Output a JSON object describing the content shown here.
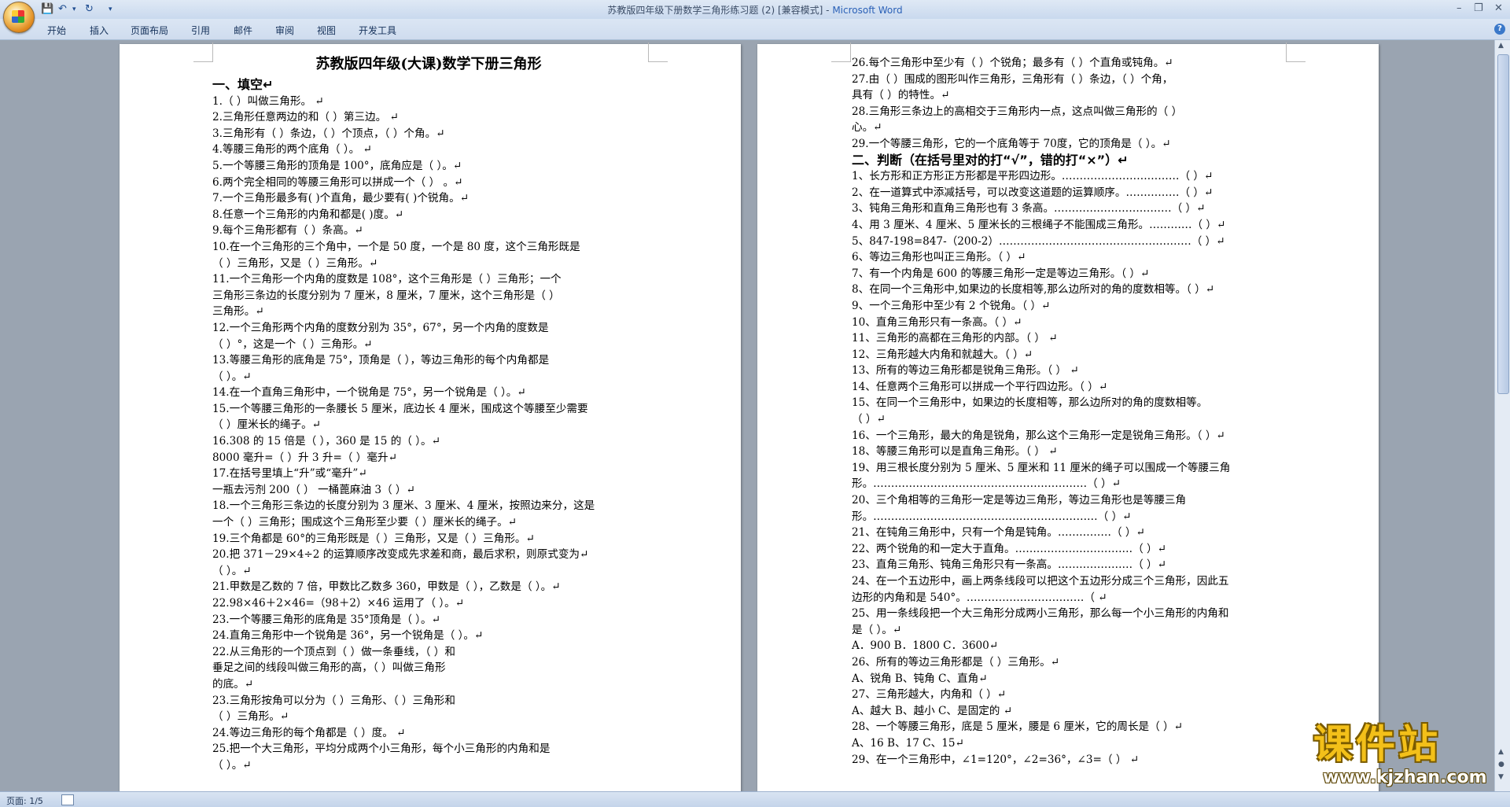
{
  "window": {
    "doc_title": "苏教版四年级下册数学三角形练习题 (2) [兼容模式] - ",
    "app_name": "Microsoft Word",
    "controls": [
      "–",
      "❐",
      "✕"
    ]
  },
  "ribbon": {
    "tabs": [
      "开始",
      "插入",
      "页面布局",
      "引用",
      "邮件",
      "审阅",
      "视图",
      "开发工具"
    ]
  },
  "left_page": {
    "title": "苏教版四年级(大课)数学下册三角形",
    "section1": "一、填空↵",
    "lines": [
      "1.（                    ）叫做三角形。 ↵",
      "2.三角形任意两边的和（            ）第三边。 ↵",
      "3.三角形有（        ）条边，（        ）个顶点，（        ）个角。↵",
      "4.等腰三角形的两个底角（            ）。 ↵",
      "5.一个等腰三角形的顶角是 100°，底角应是（          ）。↵",
      "6.两个完全相同的等腰三角形可以拼成一个（           ）                  。↵",
      "7.一个三角形最多有(       )个直角，最少要有(       )个锐角。↵",
      "8.任意一个三角形的内角和都是(       )度。↵",
      "9.每个三角形都有（      ）条高。↵",
      "10.在一个三角形的三个角中，一个是 50 度，一个是 80 度，这个三角形既是",
      "（            ）三角形，又是（            ）三角形。↵",
      "11.一个三角形一个内角的度数是 108°，这个三角形是（      ）三角形；一个",
      "三角形三条边的长度分别为 7 厘米，8 厘米，7 厘米，这个三角形是（       ）",
      "三角形。↵",
      "12.一个三角形两个内角的度数分别为 35°，67°，另一个内角的度数是",
      "（          ）°，这是一个（          ）三角形。↵",
      "13.等腰三角形的底角是 75°，顶角是（       ），等边三角形的每个内角都是",
      "（          ）。↵",
      "14.在一个直角三角形中，一个锐角是 75°，另一个锐角是（  ）。↵",
      "15.一个等腰三角形的一条腰长 5 厘米，底边长 4 厘米，围成这个等腰至少需要",
      "（        ）厘米长的绳子。↵",
      "16.308 的 15 倍是（        ），360 是 15 的（        ）。↵",
      "    8000 毫升=（        ）升     3 升=（        ）毫升↵",
      "17.在括号里填上“升”或“毫升”↵",
      "    一瓶去污剂 200（      ）          一桶蓖麻油 3（      ）↵",
      "18.一个三角形三条边的长度分别为 3 厘米、3 厘米、4 厘米，按照边来分，这是",
      "一个（        ）三角形；围成这个三角形至少要（      ）厘米长的绳子。↵",
      "19.三个角都是 60°的三角形既是（      ）三角形，又是（      ）三角形。↵",
      "20.把 371－29×4÷2 的运算顺序改变成先求差和商，最后求积，则原式变为↵",
      "（                        ）。↵",
      "21.甲数是乙数的 7 倍，甲数比乙数多 360，甲数是（      ），乙数是（      ）。↵",
      "22.98×46＋2×46=（98＋2）×46 运用了（            ）。↵",
      "23.一个等腰三角形的底角是 35°顶角是（        ）。↵",
      "24.直角三角形中一个锐角是 36°，另一个锐角是（       ）。↵",
      "22.从三角形的一个顶点到（                ）做一条垂线，（               ）和",
      "垂足之间的线段叫做三角形的高，（                              ）叫做三角形",
      "的底。↵",
      "23.三角形按角可以分为（            ）三角形、（              ）三角形和",
      "（            ）三角形。↵",
      "24.等边三角形的每个角都是（       ）度。 ↵",
      "25.把一个大三角形，平均分成两个小三角形，每个小三角形的内角和是",
      "（              ）。↵"
    ]
  },
  "right_page": {
    "lines_top": [
      "26.每个三角形中至少有（      ）个锐角；最多有（      ）个直角或钝角。↵",
      "27.由（        ）围成的图形叫作三角形，三角形有（        ）条边，（        ）个角，",
      "具有（        ）的特性。↵",
      "28.三角形三条边上的高相交于三角形内一点，这点叫做三角形的（              ）",
      "心。↵",
      "29.一个等腰三角形，它的一个底角等于 70度，它的顶角是（        ）。↵"
    ],
    "section2": "二、判断（在括号里对的打“√”，错的打“×”）↵",
    "lines_bottom": [
      "1、长方形和正方形正方形都是平形四边形。……………………………（    ）↵",
      "2、在一道算式中添减括号，可以改变这道题的运算顺序。……………（    ）↵",
      "3、钝角三角形和直角三角形也有 3 条高。……………………………（    ）↵",
      "4、用 3 厘米、4 厘米、5 厘米长的三根绳子不能围成三角形。…………（    ）↵",
      "5、847-198=847-（200-2）………………………………………………（    ）↵",
      "6、等边三角形也叫正三角形。（        ）↵",
      "7、有一个内角是 600 的等腰三角形一定是等边三角形。（        ）↵",
      "8、在同一个三角形中,如果边的长度相等,那么边所对的角的度数相等。（        ）↵",
      "9、一个三角形中至少有 2 个锐角。（        ）↵",
      "10、直角三角形只有一条高。（        ）↵",
      "11、三角形的高都在三角形的内部。（        ）  ↵",
      "12、三角形越大内角和就越大。（        ）↵",
      "13、所有的等边三角形都是锐角三角形。（        ）  ↵",
      "14、任意两个三角形可以拼成一个平行四边形。（            ）↵",
      "15、在同一个三角形中，如果边的长度相等，那么边所对的角的度数相等。",
      "（        ）↵",
      "16、一个三角形，最大的角是锐角，那么这个三角形一定是锐角三角形。（      ）↵",
      "18、等腰三角形可以是直角三角形。（        ）  ↵",
      "19、用三根长度分别为 5 厘米、5 厘米和 11 厘米的绳子可以围成一个等腰三角",
      "形。……………………………………………………（        ）↵",
      "20、三个角相等的三角形一定是等边三角形，等边三角形也是等腰三角",
      "形。………………………………………………………（    ）↵",
      "21、在钝角三角形中，只有一个角是钝角。……………（      ）↵",
      "22、两个锐角的和一定大于直角。……………………………（    ）↵",
      "23、直角三角形、钝角三角形只有一条高。…………………（    ）↵",
      "24、在一个五边形中，画上两条线段可以把这个五边形分成三个三角形，因此五",
      "边形的内角和是 540°。……………………………（    ↵",
      "25、用一条线段把一个大三角形分成两小三角形，那么每一个小三角形的内角和",
      "是（      ）。↵",
      "      A．900              B．1800          C．3600↵",
      "26、所有的等边三角形都是（            ）三角形。↵",
      "      A、锐角              B、钝角          C、直角↵",
      "27、三角形越大，内角和（        ）↵",
      "      A、越大              B、越小          C、是固定的 ↵",
      "28、一个等腰三角形，底是 5 厘米，腰是 6 厘米，它的周长是（        ）↵",
      "    A、16              B、17          C、15↵",
      "29、在一个三角形中，∠1=120°，∠2=36°，∠3=（              ）            ↵"
    ]
  },
  "status": {
    "page": "页面: 1/5"
  },
  "watermark": {
    "cn": "课件站",
    "url": "www.kjzhan.com"
  }
}
